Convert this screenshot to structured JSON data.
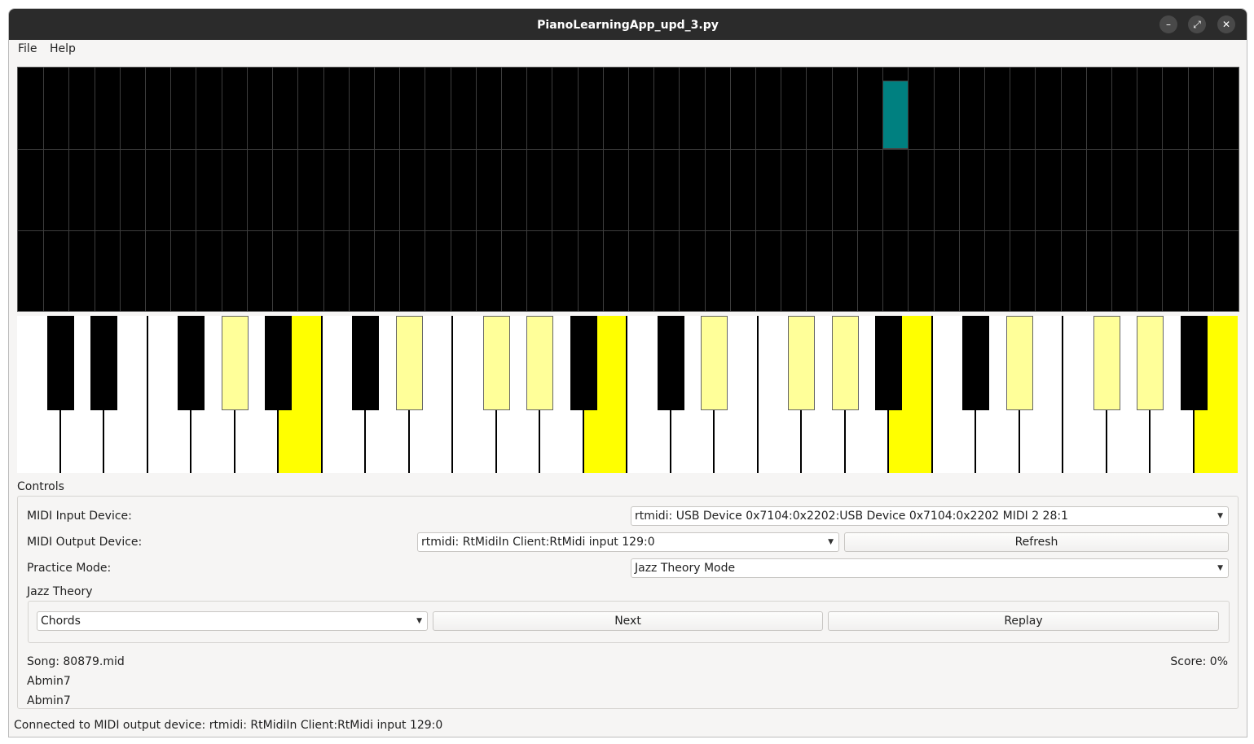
{
  "window": {
    "title": "PianoLearningApp_upd_3.py"
  },
  "menu": [
    "File",
    "Help"
  ],
  "keyboard": {
    "white_key_count": 28,
    "highlighted_white_keys": [
      6,
      13,
      20,
      27
    ],
    "black_keys_after_white": [
      0,
      1,
      3,
      4,
      5,
      7,
      8,
      10,
      11,
      12,
      14,
      15,
      17,
      18,
      19,
      21,
      22,
      24,
      25,
      26
    ],
    "highlighted_black_after_white": [
      4,
      8,
      10,
      11,
      15,
      17,
      18,
      22,
      24,
      25
    ]
  },
  "controls": {
    "group_title": "Controls",
    "midi_input_label": "MIDI Input Device:",
    "midi_input_value": "rtmidi: USB Device 0x7104:0x2202:USB Device 0x7104:0x2202 MIDI 2 28:1",
    "midi_output_label": "MIDI Output Device:",
    "midi_output_value": "rtmidi: RtMidiIn Client:RtMidi input 129:0",
    "refresh_label": "Refresh",
    "practice_mode_label": "Practice Mode:",
    "practice_mode_value": "Jazz Theory Mode",
    "jazz_title": "Jazz Theory",
    "jazz_combo_value": "Chords",
    "next_label": "Next",
    "replay_label": "Replay",
    "song_text": "Song: 80879.mid",
    "score_text": "Score: 0%",
    "chord_line_1": "Abmin7",
    "chord_line_2": "Abmin7"
  },
  "status": "Connected to MIDI output device: rtmidi: RtMidiIn Client:RtMidi input 129:0",
  "colors": {
    "highlight": "#ffff00",
    "highlight_soft": "#ffff99",
    "note": "#008080"
  }
}
